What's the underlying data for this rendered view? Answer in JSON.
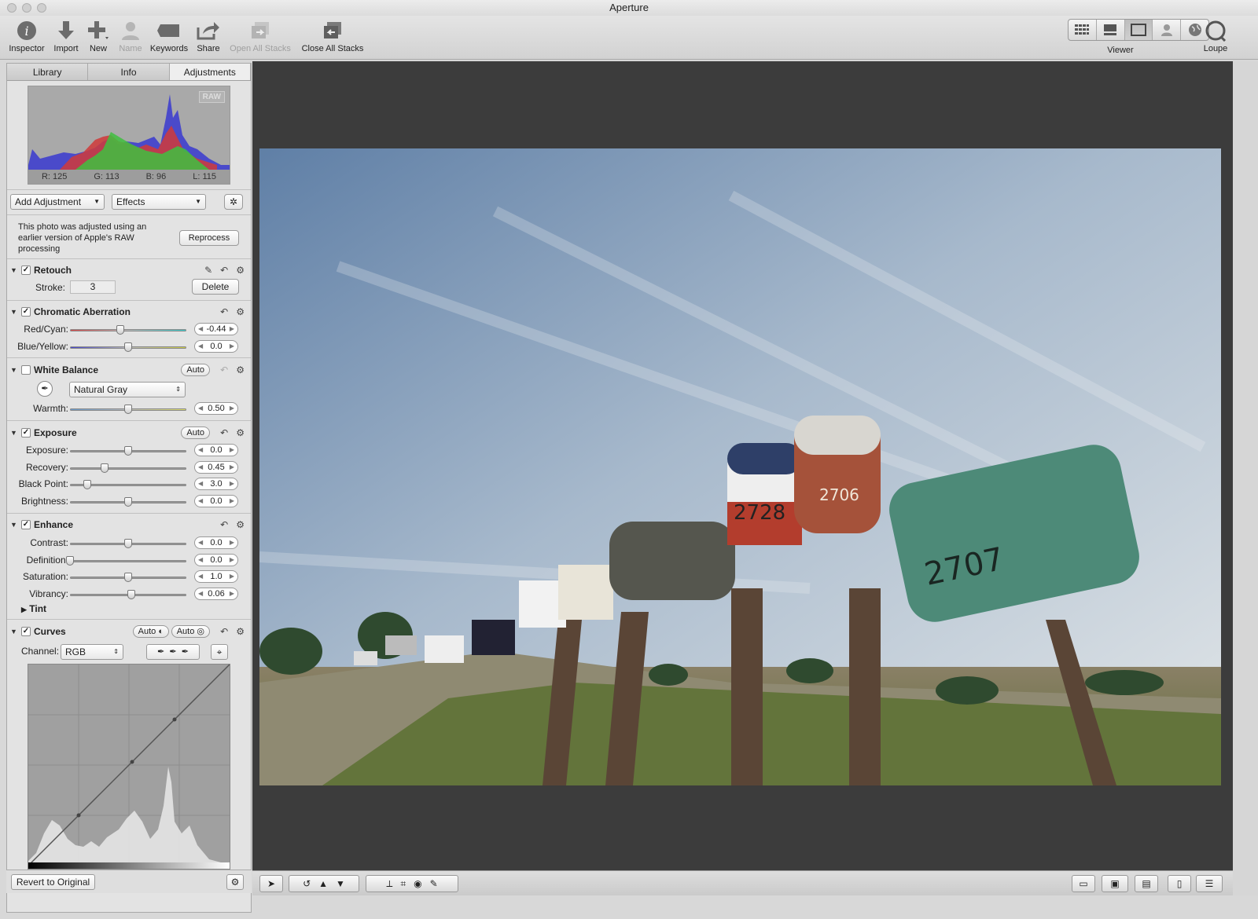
{
  "window": {
    "title": "Aperture"
  },
  "toolbar": {
    "inspector": "Inspector",
    "import": "Import",
    "new": "New",
    "name": "Name",
    "keywords": "Keywords",
    "share": "Share",
    "open_all_stacks": "Open All Stacks",
    "close_all_stacks": "Close All Stacks",
    "viewer": "Viewer",
    "loupe": "Loupe"
  },
  "inspector_tabs": [
    "Library",
    "Info",
    "Adjustments"
  ],
  "histogram": {
    "badge": "RAW",
    "r": "R: 125",
    "g": "G: 113",
    "b": "B: 96",
    "l": "L: 115"
  },
  "adjust_bar": {
    "add_adjustment": "Add Adjustment",
    "effects": "Effects"
  },
  "notice": {
    "text": "This photo was adjusted using an earlier version of Apple's RAW processing",
    "button": "Reprocess"
  },
  "retouch": {
    "title": "Retouch",
    "stroke_label": "Stroke:",
    "stroke_value": "3",
    "delete": "Delete"
  },
  "chromatic": {
    "title": "Chromatic Aberration",
    "rows": [
      {
        "label": "Red/Cyan:",
        "value": "-0.44",
        "pos": 0.43
      },
      {
        "label": "Blue/Yellow:",
        "value": "0.0",
        "pos": 0.5
      }
    ]
  },
  "white_balance": {
    "title": "White Balance",
    "auto": "Auto",
    "mode": "Natural Gray",
    "rows": [
      {
        "label": "Warmth:",
        "value": "0.50",
        "pos": 0.5
      }
    ]
  },
  "exposure": {
    "title": "Exposure",
    "auto": "Auto",
    "rows": [
      {
        "label": "Exposure:",
        "value": "0.0",
        "pos": 0.5
      },
      {
        "label": "Recovery:",
        "value": "0.45",
        "pos": 0.3
      },
      {
        "label": "Black Point:",
        "value": "3.0",
        "pos": 0.15
      },
      {
        "label": "Brightness:",
        "value": "0.0",
        "pos": 0.5
      }
    ]
  },
  "enhance": {
    "title": "Enhance",
    "rows": [
      {
        "label": "Contrast:",
        "value": "0.0",
        "pos": 0.5
      },
      {
        "label": "Definition:",
        "value": "0.0",
        "pos": 0.0
      },
      {
        "label": "Saturation:",
        "value": "1.0",
        "pos": 0.5
      },
      {
        "label": "Vibrancy:",
        "value": "0.06",
        "pos": 0.53
      }
    ],
    "tint": "Tint"
  },
  "curves": {
    "title": "Curves",
    "auto1": "Auto",
    "auto2": "Auto",
    "channel_label": "Channel:",
    "channel": "RGB"
  },
  "footer": {
    "revert": "Revert to Original"
  },
  "photo": {
    "mailbox_a": "2728",
    "mailbox_b": "2706",
    "mailbox_c": "2707"
  }
}
